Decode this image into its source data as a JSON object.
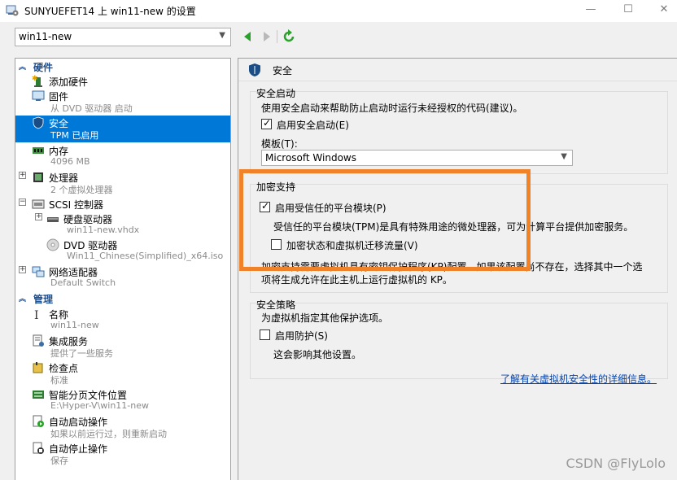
{
  "window": {
    "title": "SUNYUEFET14 上 win11-new 的设置",
    "minimize_glyph": "—",
    "maximize_glyph": "☐",
    "close_glyph": "✕"
  },
  "toolbar": {
    "vm_selected": "win11-new",
    "back_icon": "triangle-left-green-icon",
    "forward_icon": "triangle-right-gray-icon",
    "refresh_icon": "refresh-green-icon"
  },
  "tree": {
    "hardware_label": "硬件",
    "management_label": "管理",
    "hardware": [
      {
        "label": "添加硬件",
        "sub": ""
      },
      {
        "label": "固件",
        "sub": "从 DVD 驱动器 启动"
      },
      {
        "label": "安全",
        "sub": "TPM 已启用"
      },
      {
        "label": "内存",
        "sub": "4096 MB"
      },
      {
        "label": "处理器",
        "sub": "2 个虚拟处理器"
      },
      {
        "label": "SCSI 控制器",
        "sub": ""
      },
      {
        "label": "硬盘驱动器",
        "sub": "win11-new.vhdx"
      },
      {
        "label": "DVD 驱动器",
        "sub": "Win11_Chinese(Simplified)_x64.iso"
      },
      {
        "label": "网络适配器",
        "sub": "Default Switch"
      }
    ],
    "management": [
      {
        "label": "名称",
        "sub": "win11-new"
      },
      {
        "label": "集成服务",
        "sub": "提供了一些服务"
      },
      {
        "label": "检查点",
        "sub": "标准"
      },
      {
        "label": "智能分页文件位置",
        "sub": "E:\\Hyper-V\\win11-new"
      },
      {
        "label": "自动启动操作",
        "sub": "如果以前运行过，则重新启动"
      },
      {
        "label": "自动停止操作",
        "sub": "保存"
      }
    ]
  },
  "panel": {
    "header": "安全",
    "secure_boot": {
      "title": "安全启动",
      "desc": "使用安全启动来帮助防止启动时运行未经授权的代码(建议)。",
      "enable_label": "启用安全启动(E)",
      "enable_checked": true,
      "template_label": "模板(T):",
      "template_value": "Microsoft Windows"
    },
    "encryption": {
      "title": "加密支持",
      "tpm_label": "启用受信任的平台模块(P)",
      "tpm_checked": true,
      "tpm_desc": "受信任的平台模块(TPM)是具有特殊用途的微处理器，可为计算平台提供加密服务。",
      "migrate_label": "加密状态和虚拟机迁移流量(V)",
      "migrate_checked": false,
      "note_line1": "加密支持需要虚拟机具有密钥保护程序(KP)配置。如果该配置尚不存在，选择其中一个选",
      "note_line2": "项将生成允许在此主机上运行虚拟机的 KP。"
    },
    "policy": {
      "title": "安全策略",
      "desc": "为虚拟机指定其他保护选项。",
      "shield_label": "启用防护(S)",
      "shield_checked": false,
      "shield_desc": "这会影响其他设置。"
    },
    "learn_more": "了解有关虚拟机安全性的详细信息。"
  },
  "watermark": "CSDN @FlyLolo",
  "colors": {
    "selection": "#0078d7",
    "section_head": "#1e4f8f",
    "highlight": "#f0822a",
    "link": "#0645ad"
  }
}
